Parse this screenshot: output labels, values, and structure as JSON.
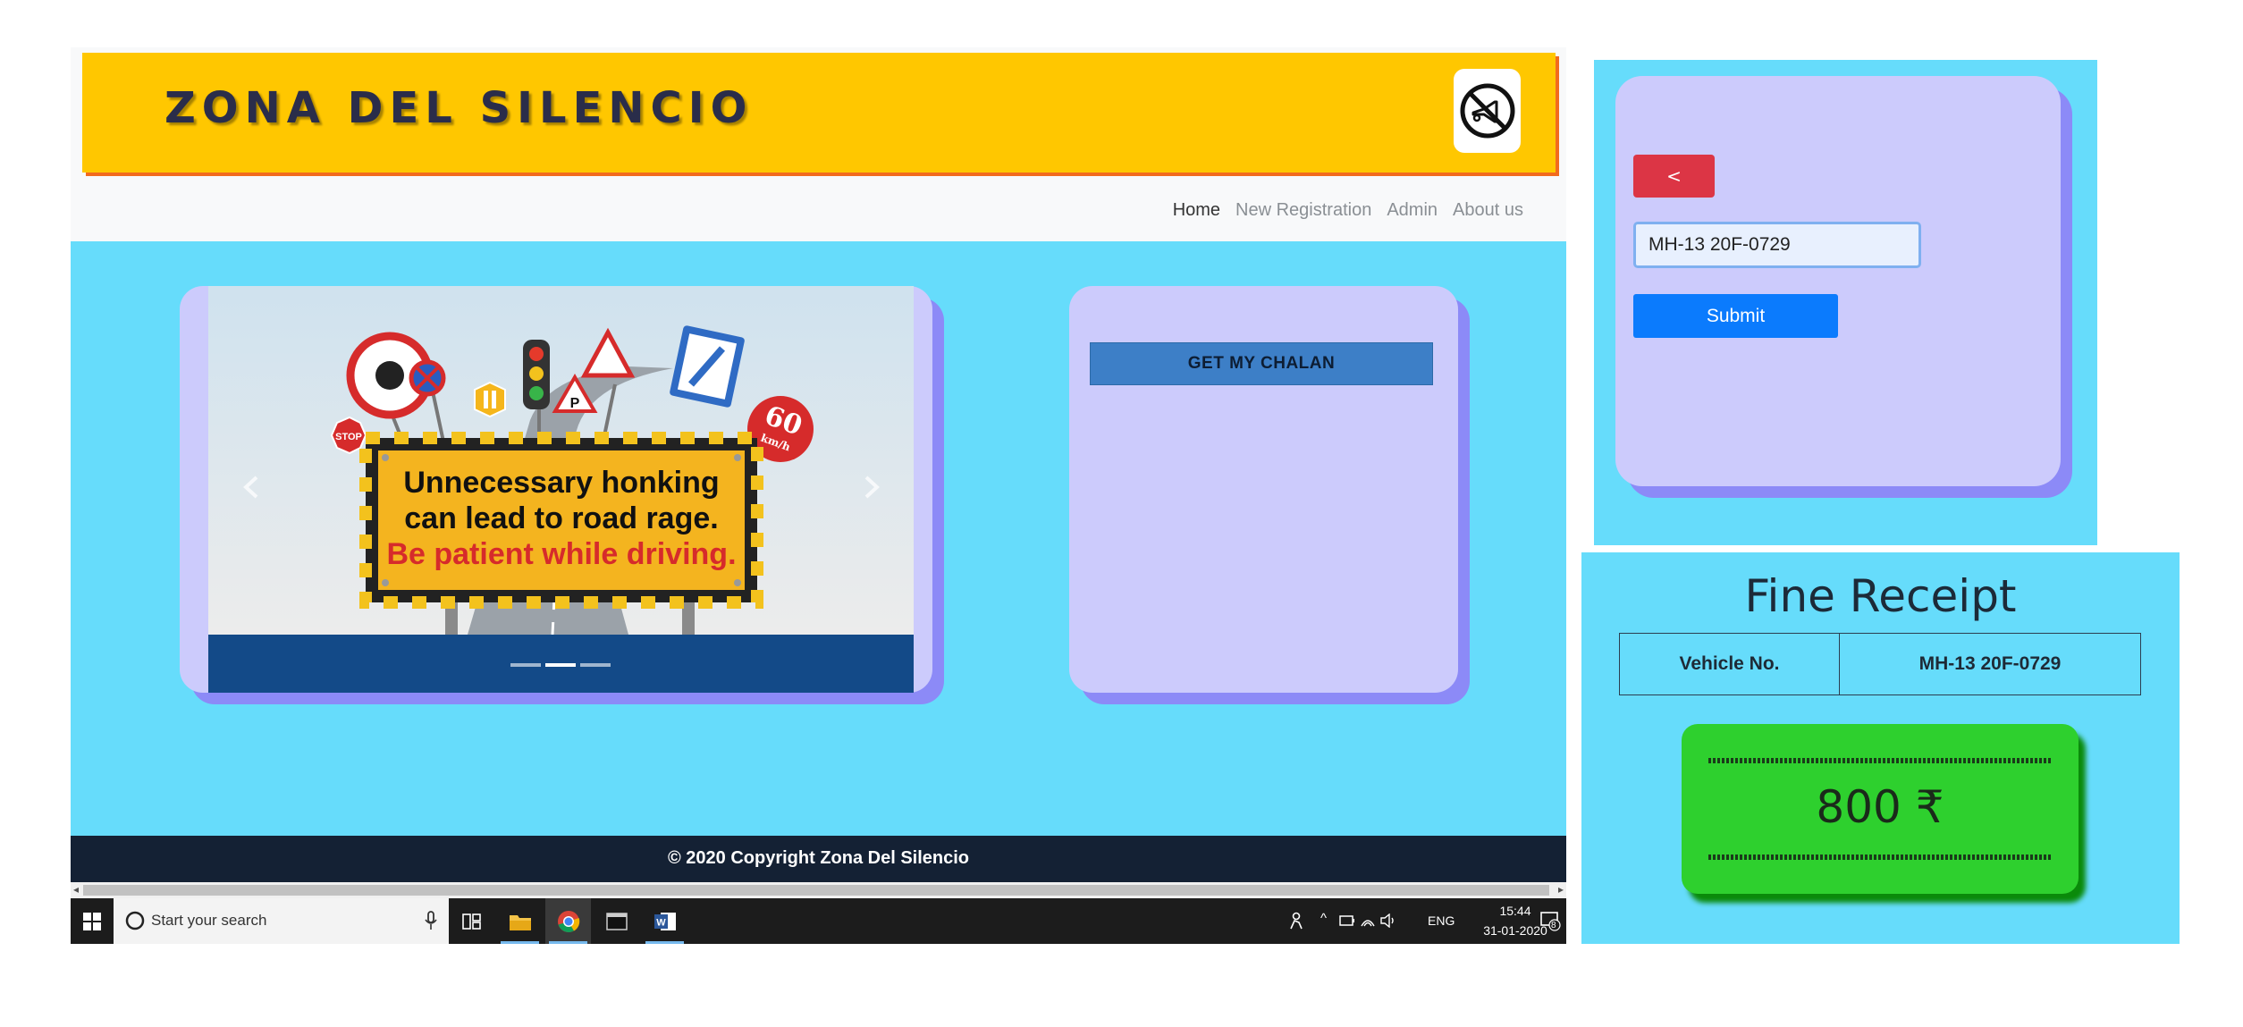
{
  "site": {
    "title": "ZONA DEL SILENCIO",
    "logo_icon": "no-horn-icon"
  },
  "nav": {
    "items": [
      {
        "label": "Home",
        "active": true
      },
      {
        "label": "New Registration",
        "active": false
      },
      {
        "label": "Admin",
        "active": false
      },
      {
        "label": "About us",
        "active": false
      }
    ]
  },
  "carousel": {
    "sign_lines": [
      "Unnecessary honking",
      "can lead to road rage.",
      "Be patient while driving."
    ],
    "speed_sign": "60",
    "speed_unit": "km/h",
    "stop_sign": "STOP",
    "parking_sign": "P",
    "prev_icon": "chevron-left-icon",
    "next_icon": "chevron-right-icon",
    "indicator_count": 3,
    "active_indicator": 1
  },
  "chalan": {
    "button_label": "GET MY CHALAN"
  },
  "footer": {
    "text": "© 2020 Copyright Zona Del Silencio"
  },
  "taskbar": {
    "search_placeholder": "Start your search",
    "language": "ENG",
    "time": "15:44",
    "date": "31-01-2020",
    "notification_count": "8"
  },
  "form": {
    "back_label": "<",
    "vehicle_value": "MH-13 20F-0729",
    "submit_label": "Submit"
  },
  "receipt": {
    "title": "Fine Receipt",
    "vehicle_label": "Vehicle No.",
    "vehicle_value": "MH-13 20F-0729",
    "amount": "800 ₹"
  },
  "colors": {
    "banner": "#ffc700",
    "content_bg": "#66dcfb",
    "card": "#cccbfc",
    "card_shadow": "#8c8af7",
    "danger": "#dc3545",
    "primary": "#0b7bfd",
    "success": "#2ed02e"
  }
}
